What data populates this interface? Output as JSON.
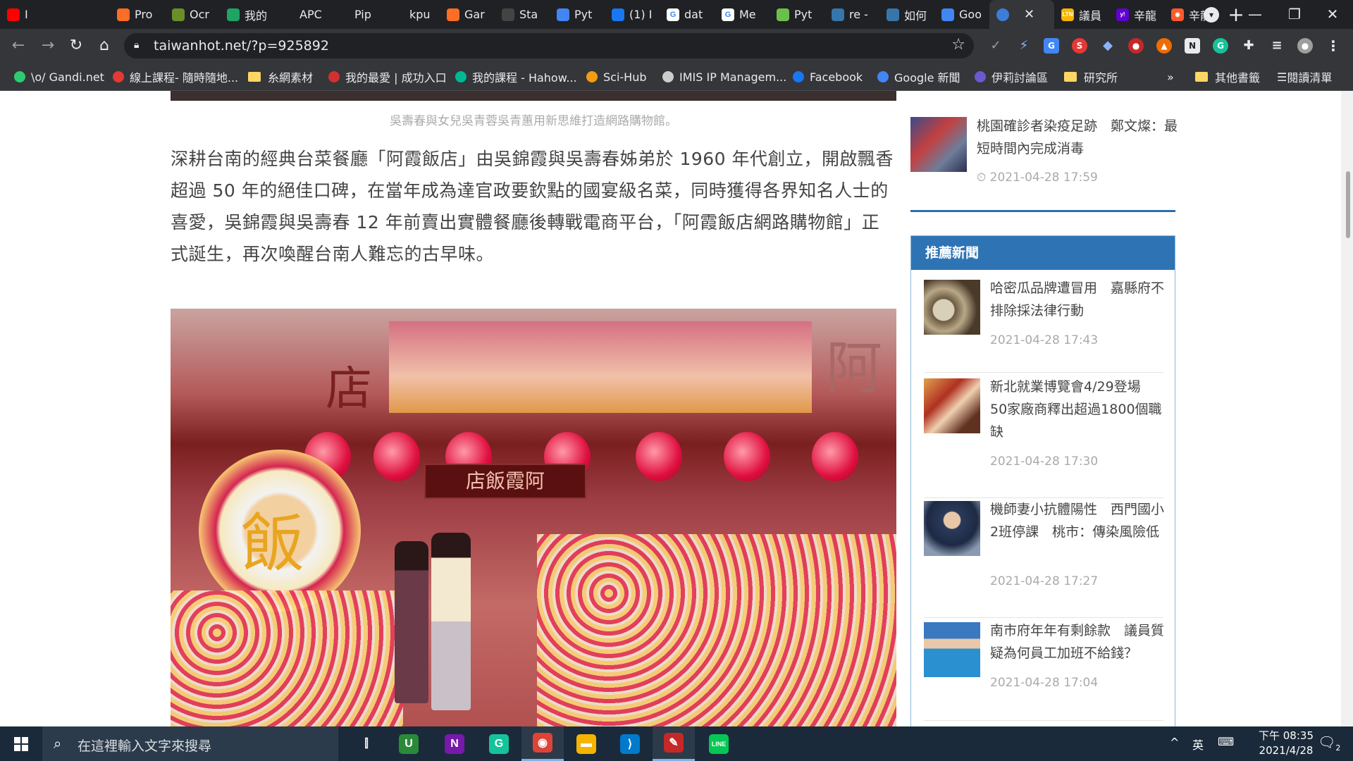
{
  "browser": {
    "tabs": [
      {
        "icon": "youtube-icon",
        "label": "I",
        "color": "#ff0000"
      },
      {
        "icon": "mute-icon",
        "label": "",
        "color": "#202124"
      },
      {
        "icon": "gitlab-icon",
        "label": "Pro",
        "color": "#fc6d26"
      },
      {
        "icon": "ocr-icon",
        "label": "Ocr",
        "color": "#6a8f2a"
      },
      {
        "icon": "drive-icon",
        "label": "我的",
        "color": "#1fa463"
      },
      {
        "icon": "github-icon",
        "label": "APC",
        "color": "#202124"
      },
      {
        "icon": "medium-icon",
        "label": "Pip",
        "color": "#202124"
      },
      {
        "icon": "github-icon",
        "label": "kpu",
        "color": "#202124"
      },
      {
        "icon": "gitlab-icon",
        "label": "Gar",
        "color": "#fc6d26"
      },
      {
        "icon": "stackedit-icon",
        "label": "Sta",
        "color": "#444"
      },
      {
        "icon": "translate-icon",
        "label": "Pyt",
        "color": "#4285f4"
      },
      {
        "icon": "facebook-icon",
        "label": "(1) I",
        "color": "#1877f2"
      },
      {
        "icon": "google-icon",
        "label": "dat",
        "color": "#ffffff"
      },
      {
        "icon": "google-icon",
        "label": "Me",
        "color": "#ffffff"
      },
      {
        "icon": "rss-icon",
        "label": "Pyt",
        "color": "#6dbf4b"
      },
      {
        "icon": "python-icon",
        "label": "re -",
        "color": "#3776ab"
      },
      {
        "icon": "python-icon",
        "label": "如何",
        "color": "#3776ab"
      },
      {
        "icon": "google-news-icon",
        "label": "Goo",
        "color": "#4285f4"
      }
    ],
    "active_tab": {
      "icon": "site-icon",
      "close": "✕"
    },
    "after_tabs": [
      {
        "icon": "ltn-icon",
        "label": "議員",
        "color": "#f7b500",
        "text": "LTN"
      },
      {
        "icon": "yahoo-icon",
        "label": "辛龍",
        "color": "#6001d2",
        "text": "y!"
      },
      {
        "icon": "news-icon",
        "label": "辛龍",
        "color": "#ff5a2d",
        "text": "◉"
      }
    ],
    "new_tab": "+",
    "window_controls": {
      "minimize": "—",
      "restore": "❐",
      "close": "✕"
    },
    "url": "taiwanhot.net/?p=925892",
    "bookmarks": [
      {
        "icon": "gandi-icon",
        "label": "\\o/ Gandi.net",
        "color": "#2ecc71"
      },
      {
        "icon": "course-icon",
        "label": "線上課程- 隨時隨地...",
        "color": "#e53935"
      },
      {
        "icon": "folder-icon",
        "label": "糸網素材",
        "color": "#fdd663"
      },
      {
        "icon": "love-icon",
        "label": "我的最愛 | 成功入口",
        "color": "#d32f2f"
      },
      {
        "icon": "hahow-icon",
        "label": "我的課程 - Hahow...",
        "color": "#00b894"
      },
      {
        "icon": "scihub-icon",
        "label": "Sci-Hub",
        "color": "#f39c12"
      },
      {
        "icon": "globe-icon",
        "label": "IMIS IP Managem...",
        "color": "#cccccc"
      },
      {
        "icon": "facebook-icon",
        "label": "Facebook",
        "color": "#1877f2"
      },
      {
        "icon": "google-news-icon",
        "label": "Google 新聞",
        "color": "#4285f4"
      },
      {
        "icon": "forum-icon",
        "label": "伊莉討論區",
        "color": "#6a5acd"
      },
      {
        "icon": "folder-icon",
        "label": "研究所",
        "color": "#fdd663"
      }
    ],
    "bookmarks_more": "»",
    "other_bookmarks": "其他書籤",
    "reading_list": "閱讀清單"
  },
  "article": {
    "image_caption": "吳壽春與女兒吳青蓉吳青蕙用新思維打造網路購物館。",
    "paragraph": "深耕台南的經典台菜餐廳「阿霞飯店」由吳錦霞與吳壽春姊弟於 1960 年代創立，開啟飄香超過 50 年的絕佳口碑，在當年成為達官政要欽點的國宴級名菜，同時獲得各界知名人士的喜愛，吳錦霞與吳壽春 12 年前賣出實體餐廳後轉戰電商平台，「阿霞飯店網路購物館」正式誕生，再次喚醒台南人難忘的古早味。",
    "photo_signs": {
      "left": "店",
      "right": "阿",
      "door": "店飯霞阿",
      "wreath": "飯"
    }
  },
  "sidebar": {
    "previous": {
      "title": "桃園確診者染疫足跡　鄭文燦：最短時間內完成消毒",
      "time": "2021-04-28 17:59"
    },
    "recommended_heading": "推薦新聞",
    "recommended": [
      {
        "title": "哈密瓜品牌遭冒用　嘉縣府不排除採法律行動",
        "time": "2021-04-28 17:43"
      },
      {
        "title": "新北就業博覽會4/29登場　50家廠商釋出超過1800個職缺",
        "time": "2021-04-28 17:30"
      },
      {
        "title": "機師妻小抗體陽性　西門國小2班停課　桃市：傳染風險低",
        "time": "2021-04-28 17:27"
      },
      {
        "title": "南市府年年有剩餘款　議員質疑為何員工加班不給錢？",
        "time": "2021-04-28 17:04"
      }
    ]
  },
  "taskbar": {
    "search_placeholder": "在這裡輸入文字來搜尋",
    "apps": [
      {
        "icon": "task-view-icon",
        "text": "⫿",
        "color": "transparent"
      },
      {
        "icon": "upwork-icon",
        "text": "U",
        "color": "#2a8a3a"
      },
      {
        "icon": "onenote-icon",
        "text": "N",
        "color": "#7719aa"
      },
      {
        "icon": "grammarly-icon",
        "text": "G",
        "color": "#15c39a"
      },
      {
        "icon": "chrome-icon",
        "text": "◉",
        "color": "#db4437"
      },
      {
        "icon": "file-explorer-icon",
        "text": "▬",
        "color": "#f4b400"
      },
      {
        "icon": "vscode-icon",
        "text": "⟩",
        "color": "#007acc"
      },
      {
        "icon": "pen-app-icon",
        "text": "✎",
        "color": "#c62828"
      },
      {
        "icon": "line-icon",
        "text": "LINE",
        "color": "#06c755"
      }
    ],
    "tray_caret": "^",
    "ime": "英",
    "time_period": "下午 08:35",
    "date": "2021/4/28",
    "notifications": "2"
  }
}
